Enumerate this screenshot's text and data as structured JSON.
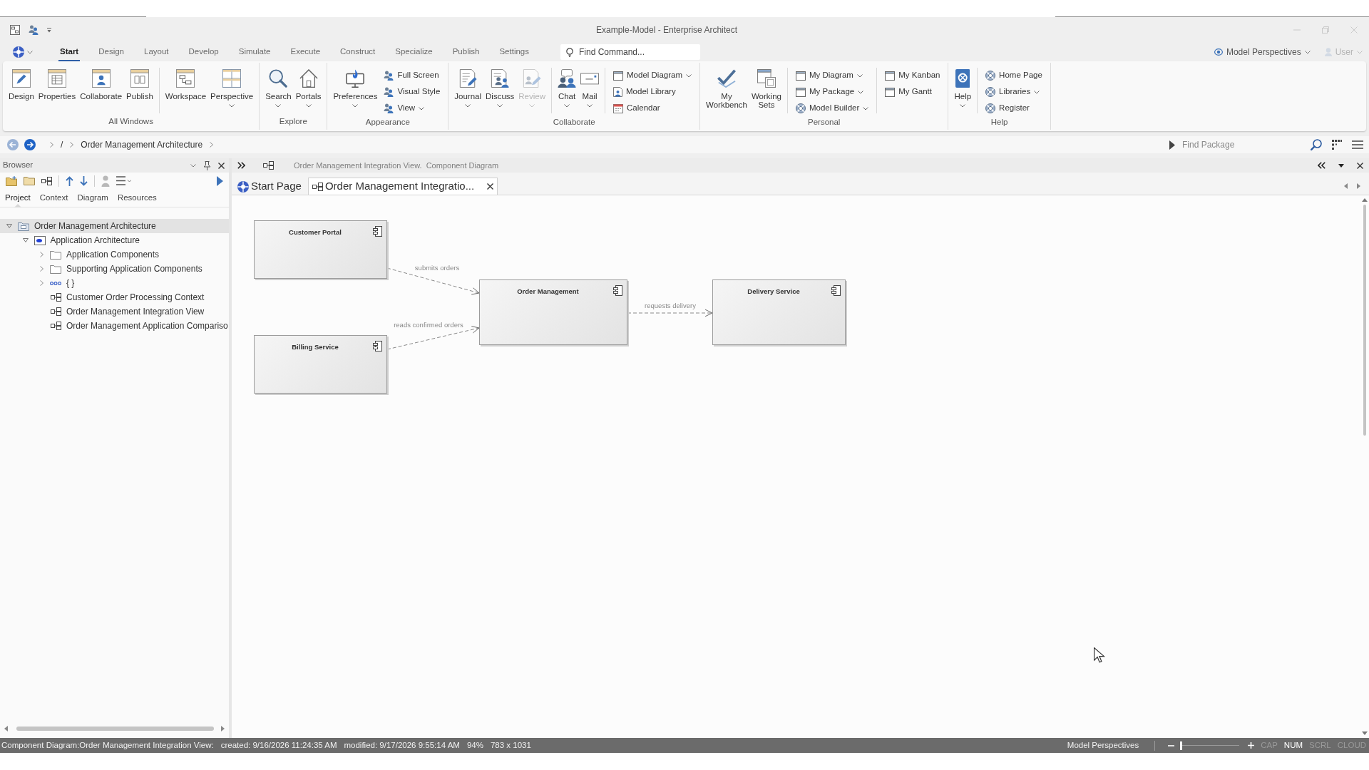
{
  "window": {
    "title": "Example-Model - Enterprise Architect"
  },
  "ribbon": {
    "tabs": [
      {
        "label": "Start",
        "selected": true
      },
      {
        "label": "Design",
        "selected": false
      },
      {
        "label": "Layout",
        "selected": false
      },
      {
        "label": "Develop",
        "selected": false
      },
      {
        "label": "Simulate",
        "selected": false
      },
      {
        "label": "Execute",
        "selected": false
      },
      {
        "label": "Construct",
        "selected": false
      },
      {
        "label": "Specialize",
        "selected": false
      },
      {
        "label": "Publish",
        "selected": false
      },
      {
        "label": "Settings",
        "selected": false
      }
    ],
    "find_command": {
      "placeholder": "Find Command..."
    },
    "perspectives": {
      "label": "Model Perspectives"
    },
    "user": {
      "label": "User",
      "disabled": true
    },
    "groups": [
      {
        "label": "All Windows",
        "items": [
          {
            "kind": "large",
            "label": "Design",
            "dropdown": false,
            "disabled": false
          },
          {
            "kind": "large",
            "label": "Properties",
            "dropdown": false,
            "disabled": false
          },
          {
            "kind": "large",
            "label": "Collaborate",
            "dropdown": false,
            "disabled": false
          },
          {
            "kind": "large",
            "label": "Publish",
            "dropdown": false,
            "disabled": false
          },
          {
            "kind": "separator"
          },
          {
            "kind": "large",
            "label": "Workspace",
            "dropdown": false,
            "disabled": false
          },
          {
            "kind": "large",
            "label": "Perspective",
            "dropdown": true,
            "disabled": false
          }
        ]
      },
      {
        "label": "Explore",
        "items": [
          {
            "kind": "large",
            "label": "Search",
            "dropdown": true,
            "disabled": false
          },
          {
            "kind": "large",
            "label": "Portals",
            "dropdown": true,
            "disabled": false
          }
        ]
      },
      {
        "label": "Appearance",
        "items": [
          {
            "kind": "large",
            "label": "Preferences",
            "dropdown": true,
            "disabled": false
          },
          {
            "kind": "small",
            "label": "Full Screen",
            "dropdown": false,
            "disabled": false
          },
          {
            "kind": "small",
            "label": "Visual Style",
            "dropdown": false,
            "disabled": false
          },
          {
            "kind": "small",
            "label": "View",
            "dropdown": true,
            "disabled": false
          }
        ]
      },
      {
        "label": "Collaborate",
        "items": [
          {
            "kind": "large",
            "label": "Journal",
            "dropdown": true,
            "disabled": false
          },
          {
            "kind": "large",
            "label": "Discuss",
            "dropdown": true,
            "disabled": false
          },
          {
            "kind": "large",
            "label": "Review",
            "dropdown": true,
            "disabled": true
          },
          {
            "kind": "separator"
          },
          {
            "kind": "large",
            "label": "Chat",
            "dropdown": true,
            "disabled": false
          },
          {
            "kind": "large",
            "label": "Mail",
            "dropdown": true,
            "disabled": false
          },
          {
            "kind": "separator"
          },
          {
            "kind": "small",
            "label": "Model Diagram",
            "dropdown": true,
            "disabled": false
          },
          {
            "kind": "small",
            "label": "Model Library",
            "dropdown": false,
            "disabled": false
          },
          {
            "kind": "small",
            "label": "Calendar",
            "dropdown": false,
            "disabled": false
          }
        ]
      },
      {
        "label": "Personal",
        "items": [
          {
            "kind": "large",
            "label": "My Workbench",
            "dropdown": false,
            "disabled": false
          },
          {
            "kind": "large",
            "label": "Working Sets",
            "dropdown": false,
            "disabled": false
          },
          {
            "kind": "separator"
          },
          {
            "kind": "small",
            "label": "My Diagram",
            "dropdown": true,
            "disabled": false
          },
          {
            "kind": "small",
            "label": "My Package",
            "dropdown": true,
            "disabled": false
          },
          {
            "kind": "small",
            "label": "Model Builder",
            "dropdown": true,
            "disabled": false
          },
          {
            "kind": "separator"
          },
          {
            "kind": "small",
            "label": "My Kanban",
            "dropdown": false,
            "disabled": false
          },
          {
            "kind": "small",
            "label": "My Gantt",
            "dropdown": false,
            "disabled": false
          }
        ]
      },
      {
        "label": "Help",
        "items": [
          {
            "kind": "large",
            "label": "Help",
            "dropdown": true,
            "disabled": false
          },
          {
            "kind": "separator"
          },
          {
            "kind": "small",
            "label": "Home Page",
            "dropdown": false,
            "disabled": false
          },
          {
            "kind": "small",
            "label": "Libraries",
            "dropdown": true,
            "disabled": false
          },
          {
            "kind": "small",
            "label": "Register",
            "dropdown": false,
            "disabled": false
          }
        ]
      }
    ]
  },
  "breadcrumb": {
    "items": [
      {
        "label": "/"
      },
      {
        "label": "Order Management Architecture"
      }
    ],
    "find_package": {
      "placeholder": "Find Package"
    }
  },
  "browser": {
    "title": "Browser",
    "tabs": [
      {
        "label": "Project",
        "selected": true
      },
      {
        "label": "Context",
        "selected": false
      },
      {
        "label": "Diagram",
        "selected": false
      },
      {
        "label": "Resources",
        "selected": false
      }
    ],
    "tree": [
      {
        "kind": "model",
        "label": "Order Management Architecture",
        "expanded": true,
        "selected": true,
        "children": [
          {
            "kind": "view",
            "label": "Application Architecture",
            "expanded": true,
            "selected": false,
            "children": [
              {
                "kind": "folder",
                "label": "Application Components",
                "expanded": false,
                "selected": false
              },
              {
                "kind": "folder",
                "label": "Supporting Application Components",
                "expanded": false,
                "selected": false
              },
              {
                "kind": "element",
                "label": "{ }",
                "expanded": false,
                "selected": false
              },
              {
                "kind": "diagram",
                "label": "Customer Order Processing Context",
                "selected": false
              },
              {
                "kind": "diagram",
                "label": "Order Management Integration View",
                "selected": false
              },
              {
                "kind": "diagram",
                "label": "Order Management Application Compariso",
                "selected": false
              }
            ]
          }
        ]
      }
    ]
  },
  "document": {
    "header": "Order Management Integration View.  Component Diagram",
    "tabs": [
      {
        "kind": "start",
        "label": "Start Page",
        "selected": false
      },
      {
        "kind": "diagram",
        "label": "Order Management Integratio...",
        "selected": true
      }
    ],
    "diagram": {
      "nodes": [
        {
          "name": "Customer Portal"
        },
        {
          "name": "Billing Service"
        },
        {
          "name": "Order Management"
        },
        {
          "name": "Delivery Service"
        }
      ],
      "edges": [
        {
          "label": "submits orders"
        },
        {
          "label": "reads confirmed orders"
        },
        {
          "label": "requests delivery"
        }
      ]
    }
  },
  "status_bar": {
    "texts": [
      "Component Diagram:Order Management Integration View:",
      "created: 9/16/2026 11:24:35 AM",
      "modified: 9/17/2026 9:55:14 AM",
      "94%",
      "783 x 1031"
    ],
    "perspectives": "Model Perspectives",
    "zoom": {
      "level": 0
    },
    "indicators": [
      {
        "label": "CAP",
        "on": false
      },
      {
        "label": "NUM",
        "on": true
      },
      {
        "label": "SCRL",
        "on": false
      },
      {
        "label": "CLOUD",
        "on": false
      }
    ]
  }
}
